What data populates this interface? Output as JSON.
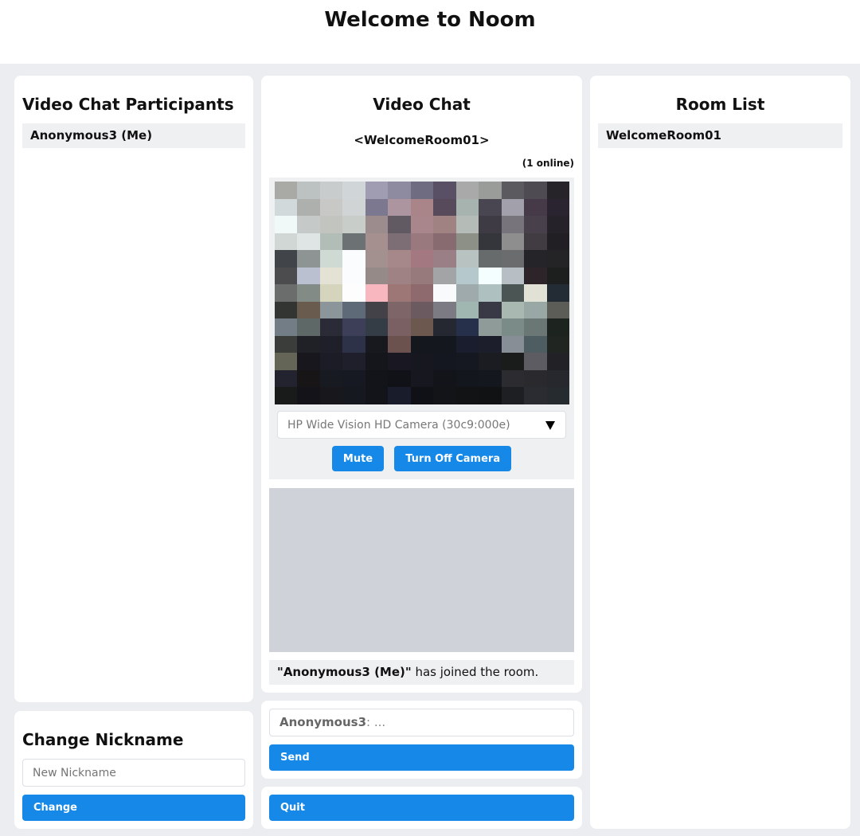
{
  "page": {
    "title": "Welcome to Noom"
  },
  "participants": {
    "heading": "Video Chat Participants",
    "items": [
      {
        "label": "Anonymous3 (Me)"
      }
    ]
  },
  "nickname": {
    "heading": "Change Nickname",
    "input_placeholder": "New Nickname",
    "button_label": "Change"
  },
  "video_chat": {
    "heading": "Video Chat",
    "room_name_display": "<WelcomeRoom01>",
    "online_count": "(1 online)",
    "camera_select": {
      "selected": "HP Wide Vision HD Camera (30c9:000e)"
    },
    "mute_label": "Mute",
    "camera_toggle_label": "Turn Off Camera",
    "system_message": {
      "user": "\"Anonymous3 (Me)\"",
      "text": " has joined the room."
    }
  },
  "message_composer": {
    "nickname_prefix": "Anonymous3",
    "placeholder_suffix": ": ...",
    "send_label": "Send"
  },
  "quit": {
    "label": "Quit"
  },
  "room_list": {
    "heading": "Room List",
    "items": [
      {
        "label": "WelcomeRoom01"
      }
    ]
  },
  "colors": {
    "accent": "#1588e8",
    "page_background": "#ebedf0",
    "list_item_background": "#eff0f2",
    "remote_video_placeholder": "#cfd2d9"
  },
  "icons": {
    "dropdown": "triangle-down-icon"
  }
}
